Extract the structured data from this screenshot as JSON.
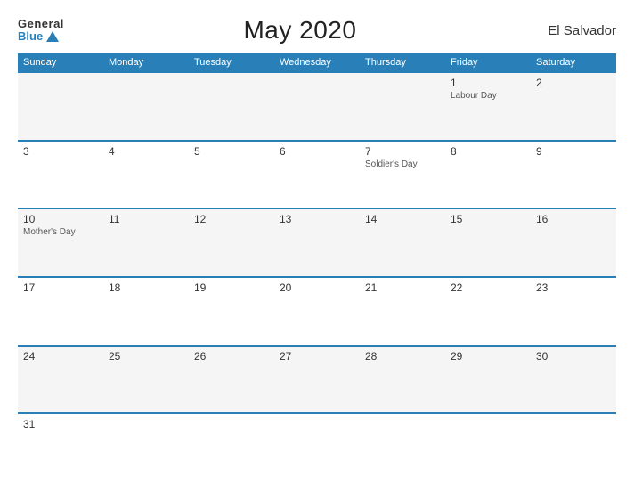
{
  "logo": {
    "general": "General",
    "blue": "Blue"
  },
  "title": "May 2020",
  "country": "El Salvador",
  "headers": [
    "Sunday",
    "Monday",
    "Tuesday",
    "Wednesday",
    "Thursday",
    "Friday",
    "Saturday"
  ],
  "weeks": [
    [
      {
        "day": "",
        "event": ""
      },
      {
        "day": "",
        "event": ""
      },
      {
        "day": "",
        "event": ""
      },
      {
        "day": "",
        "event": ""
      },
      {
        "day": "",
        "event": ""
      },
      {
        "day": "1",
        "event": "Labour Day"
      },
      {
        "day": "2",
        "event": ""
      }
    ],
    [
      {
        "day": "3",
        "event": ""
      },
      {
        "day": "4",
        "event": ""
      },
      {
        "day": "5",
        "event": ""
      },
      {
        "day": "6",
        "event": ""
      },
      {
        "day": "7",
        "event": "Soldier's Day"
      },
      {
        "day": "8",
        "event": ""
      },
      {
        "day": "9",
        "event": ""
      }
    ],
    [
      {
        "day": "10",
        "event": "Mother's Day"
      },
      {
        "day": "11",
        "event": ""
      },
      {
        "day": "12",
        "event": ""
      },
      {
        "day": "13",
        "event": ""
      },
      {
        "day": "14",
        "event": ""
      },
      {
        "day": "15",
        "event": ""
      },
      {
        "day": "16",
        "event": ""
      }
    ],
    [
      {
        "day": "17",
        "event": ""
      },
      {
        "day": "18",
        "event": ""
      },
      {
        "day": "19",
        "event": ""
      },
      {
        "day": "20",
        "event": ""
      },
      {
        "day": "21",
        "event": ""
      },
      {
        "day": "22",
        "event": ""
      },
      {
        "day": "23",
        "event": ""
      }
    ],
    [
      {
        "day": "24",
        "event": ""
      },
      {
        "day": "25",
        "event": ""
      },
      {
        "day": "26",
        "event": ""
      },
      {
        "day": "27",
        "event": ""
      },
      {
        "day": "28",
        "event": ""
      },
      {
        "day": "29",
        "event": ""
      },
      {
        "day": "30",
        "event": ""
      }
    ],
    [
      {
        "day": "31",
        "event": ""
      },
      {
        "day": "",
        "event": ""
      },
      {
        "day": "",
        "event": ""
      },
      {
        "day": "",
        "event": ""
      },
      {
        "day": "",
        "event": ""
      },
      {
        "day": "",
        "event": ""
      },
      {
        "day": "",
        "event": ""
      }
    ]
  ]
}
